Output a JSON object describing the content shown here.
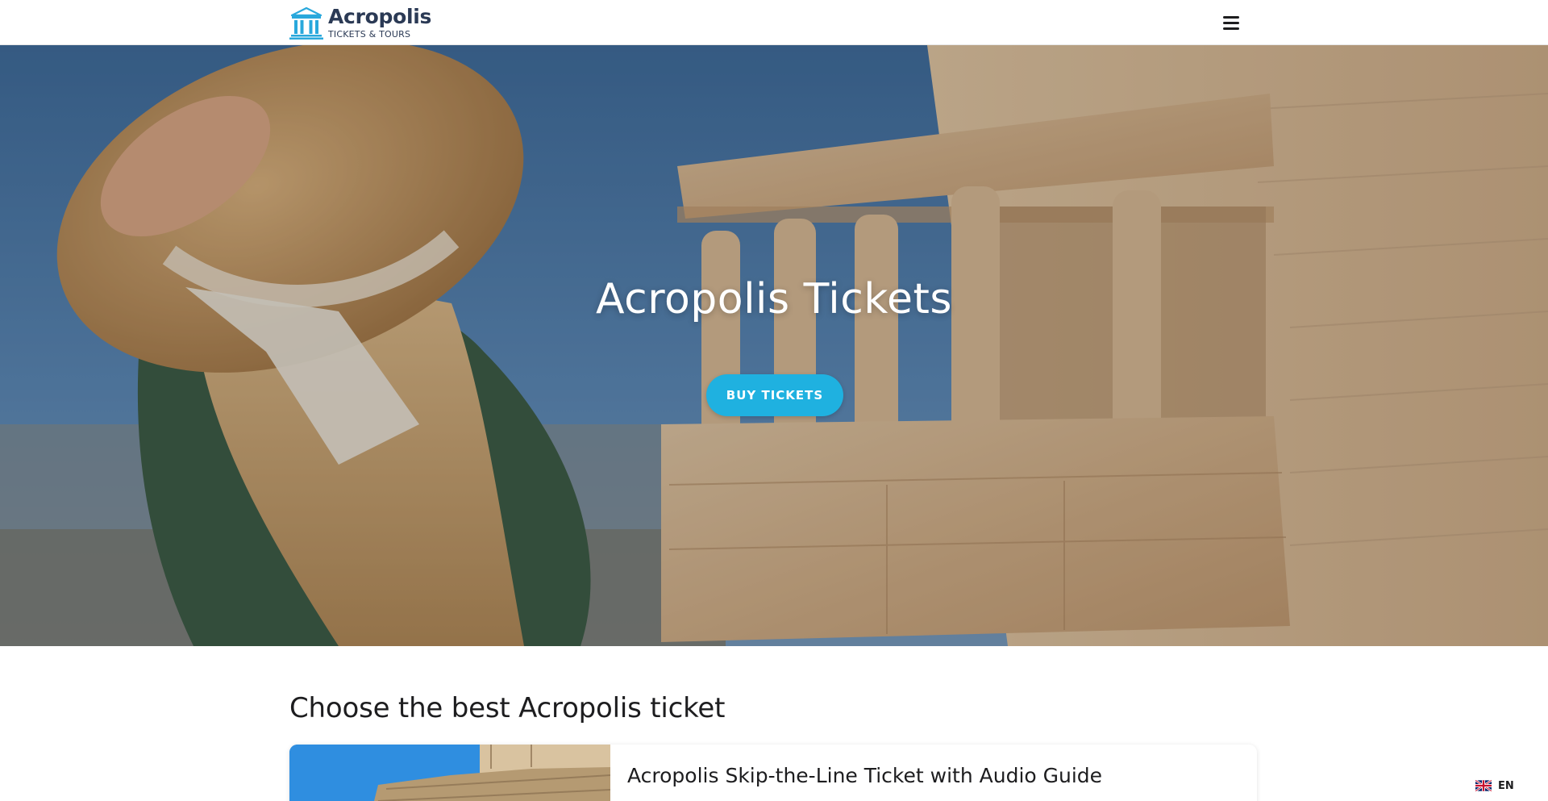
{
  "header": {
    "logo_title": "Acropolis",
    "logo_subtitle": "TICKETS & TOURS",
    "menu_icon": "hamburger-menu-icon"
  },
  "hero": {
    "title": "Acropolis Tickets",
    "cta_label": "BUY TICKETS",
    "background_image": "caryatids-erechtheion-with-woman-in-straw-hat"
  },
  "products": {
    "heading": "Choose the best Acropolis ticket",
    "items": [
      {
        "title": "Acropolis Skip-the-Line Ticket with Audio Guide",
        "image": "acropolis-marble-ruins"
      }
    ]
  },
  "language": {
    "label": "EN",
    "flag_icon": "uk-flag-icon"
  },
  "colors": {
    "accent": "#1fb1e0",
    "logo_text": "#2b3a55",
    "logo_mark": "#29a8dc",
    "text": "#1d1d1f"
  }
}
